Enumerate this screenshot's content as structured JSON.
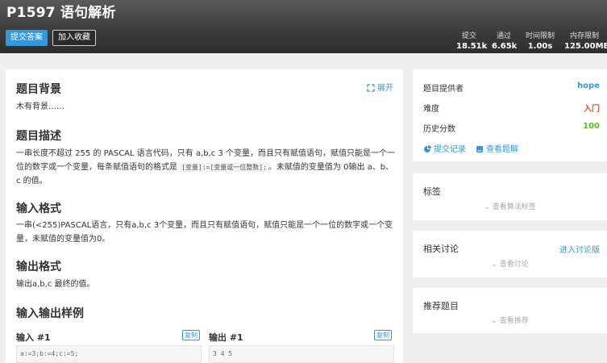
{
  "header": {
    "title": "P1597 语句解析",
    "submit_label": "提交答案",
    "favorite_label": "加入收藏",
    "stats": [
      {
        "label": "提交",
        "value": "18.51k"
      },
      {
        "label": "通过",
        "value": "6.65k"
      },
      {
        "label": "时间限制",
        "value": "1.00s"
      },
      {
        "label": "内存限制",
        "value": "125.00MB"
      }
    ]
  },
  "problem": {
    "expand_label": "展开",
    "sections": {
      "background_title": "题目背景",
      "background_text": "木有背景……",
      "description_title": "题目描述",
      "description_text_1": "一串长度不超过 255 的 PASCAL 语言代码，只有 a,b,c 3 个变量，而且只有赋值语句，赋值只能是一个一位的数字或一个变量，每条赋值语句的格式是",
      "description_code": "[变量]:=[变量或一位整数];",
      "description_text_2": "。未赋值的变量值为 0输出 a、b、c 的值。",
      "input_title": "输入格式",
      "input_text": "一串(<255)PASCAL语言，只有a,b,c 3个变量，而且只有赋值语句，赋值只能是一个一位的数字或一个变量，未赋值的变量值为0。",
      "output_title": "输出格式",
      "output_text": "输出a,b,c 最终的值。",
      "samples_title": "输入输出样例"
    },
    "samples": {
      "input_label": "输入 #1",
      "output_label": "输出 #1",
      "copy_label": "复制",
      "input_value": "a:=3;b:=4;c:=5;",
      "output_value": "3 4 5"
    }
  },
  "info_card": {
    "provider_label": "题目提供者",
    "provider_value": "hope",
    "difficulty_label": "难度",
    "difficulty_value": "入门",
    "score_label": "历史分数",
    "score_value": "100",
    "submissions_link": "提交记录",
    "solutions_link": "查看题解"
  },
  "tags_card": {
    "title": "标签",
    "hint": "查看算法标签"
  },
  "discuss_card": {
    "title": "相关讨论",
    "link": "进入讨论版",
    "hint": "查看讨论"
  },
  "recommend_card": {
    "title": "推荐题目",
    "hint": "查看推荐"
  },
  "colors": {
    "accent": "#3498db",
    "difficulty": "#e74c3c",
    "score": "#52c41a"
  }
}
